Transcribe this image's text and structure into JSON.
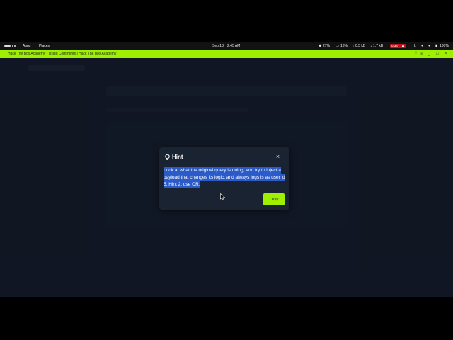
{
  "topbar": {
    "apps": "Apps",
    "places": "Places",
    "date": "Sep 13",
    "time": "2:45 AM",
    "cpu": "27%",
    "mem": "18%",
    "up": "0.5 kB",
    "down": "1.7 kB",
    "rec_time": "0:38",
    "lang": "L",
    "battery": "100%"
  },
  "window": {
    "title": "Hack The Box Academy - Using Comments | Hack The Box Academy",
    "controls": [
      "⋮",
      "≡",
      "_",
      "□",
      "×"
    ]
  },
  "modal": {
    "title": "Hint",
    "body": "Look at what the original query is doing, and try to inject a payload that changes its logic, and always logs is as user id 5. Hint 2: use OR.",
    "ok_label": "Okay",
    "close_glyph": "×"
  },
  "colors": {
    "accent": "#9fef00",
    "page_bg": "#141d2b",
    "modal_bg": "#1a2332",
    "selection": "#2b5bc8",
    "record": "#c0121b"
  }
}
